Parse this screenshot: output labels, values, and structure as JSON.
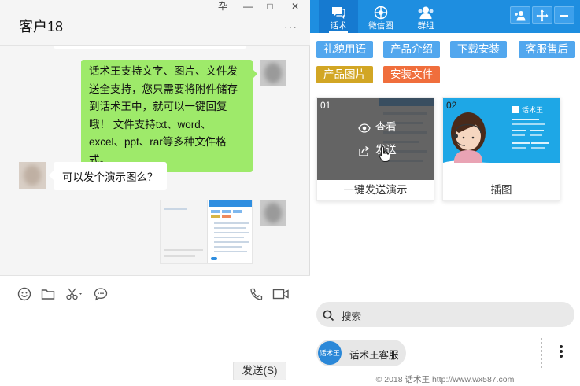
{
  "chat": {
    "title": "客户18",
    "window_controls": {
      "pin": "卆",
      "minimize": "—",
      "maximize": "□",
      "close": "✕"
    },
    "more": "···",
    "messages": [
      {
        "side": "right",
        "type": "text",
        "text": "话术王支持文字、图片、文件发送全支持，您只需要将附件储存到话术王中，就可以一键回复哦！ 文件支持txt、word、excel、ppt、rar等多种文件格式。"
      },
      {
        "side": "left",
        "type": "text",
        "text": "可以发个演示图么？"
      },
      {
        "side": "right",
        "type": "image"
      }
    ],
    "toolbar_icons": [
      "emoji-icon",
      "folder-icon",
      "scissors-icon",
      "chat-bubble-icon",
      "phone-icon",
      "video-icon"
    ],
    "send_label": "发送(S)"
  },
  "panel": {
    "nav_tabs": [
      {
        "label": "话术",
        "icon": "chat-icon",
        "active": true
      },
      {
        "label": "微信圈",
        "icon": "moments-icon",
        "active": false
      },
      {
        "label": "群组",
        "icon": "group-icon",
        "active": false
      }
    ],
    "nav_buttons": [
      "add-user-icon",
      "move-icon",
      "minimize-icon"
    ],
    "categories": [
      {
        "label": "礼貌用语",
        "color": "#52a7ee"
      },
      {
        "label": "产品介绍",
        "color": "#52a7ee"
      },
      {
        "label": "下载安装",
        "color": "#52a7ee"
      },
      {
        "label": "客服售后",
        "color": "#52a7ee"
      },
      {
        "label": "产品图片",
        "color": "#d2a624"
      },
      {
        "label": "安装文件",
        "color": "#f06e3c"
      }
    ],
    "cards": [
      {
        "num": "01",
        "caption": "一键发送演示",
        "hover_view": "查看",
        "hover_send": "发送"
      },
      {
        "num": "02",
        "caption": "插图",
        "brand": "话术王"
      }
    ],
    "search_placeholder": "搜索",
    "agent_badge": "话术王",
    "agent_name": "话术王客服",
    "footer": "© 2018 话术王 http://www.wx587.com"
  },
  "colors": {
    "nav_blue": "#1e8ee0",
    "chat_green": "#9eea6a",
    "tag_blue": "#52a7ee",
    "tag_gold": "#d2a624",
    "tag_orange": "#f06e3c"
  }
}
